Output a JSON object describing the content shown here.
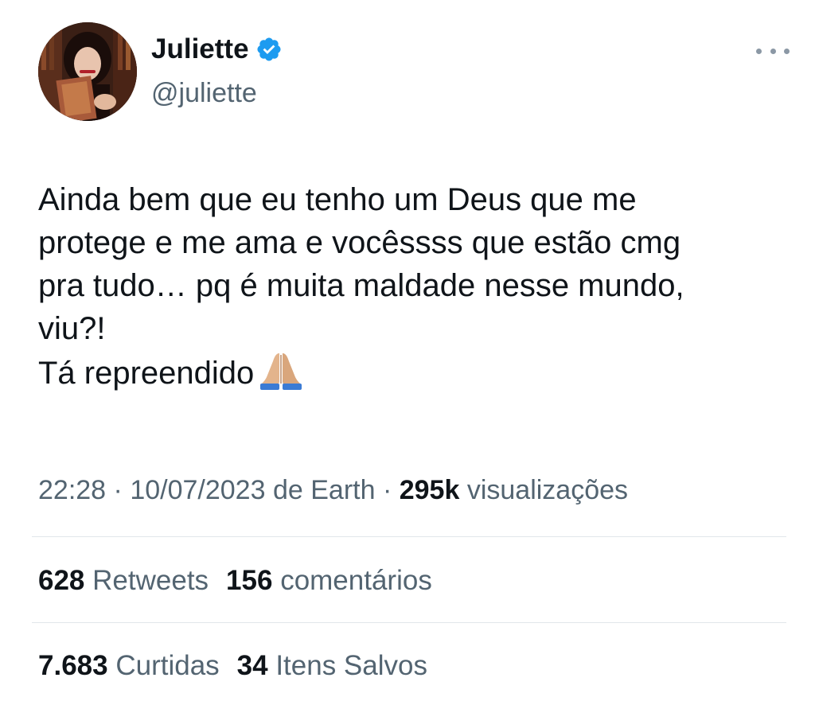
{
  "author": {
    "name": "Juliette",
    "handle": "@juliette",
    "verified_color": "#1d9bf0",
    "avatar_icon": "profile-photo",
    "more_icon": "more-dots-icon"
  },
  "tweet": {
    "text": "Ainda bem que eu tenho um Deus que me\nprotege e me ama e vocêssss que estão cmg\npra tudo… pq é muita maldade nesse mundo,\nviu?!\nTá repreendido",
    "emoji": "folded-hands-emoji"
  },
  "meta": {
    "time": "22:28",
    "date": "10/07/2023",
    "source_prefix": "de",
    "source": "Earth",
    "views_count": "295k",
    "views_label": "visualizações"
  },
  "stats": {
    "retweets_count": "628",
    "retweets_label": "Retweets",
    "comments_count": "156",
    "comments_label": "comentários",
    "likes_count": "7.683",
    "likes_label": "Curtidas",
    "saves_count": "34",
    "saves_label": "Itens Salvos"
  },
  "colors": {
    "text": "#0f1419",
    "secondary": "#536471",
    "divider": "#e1e6ea"
  }
}
